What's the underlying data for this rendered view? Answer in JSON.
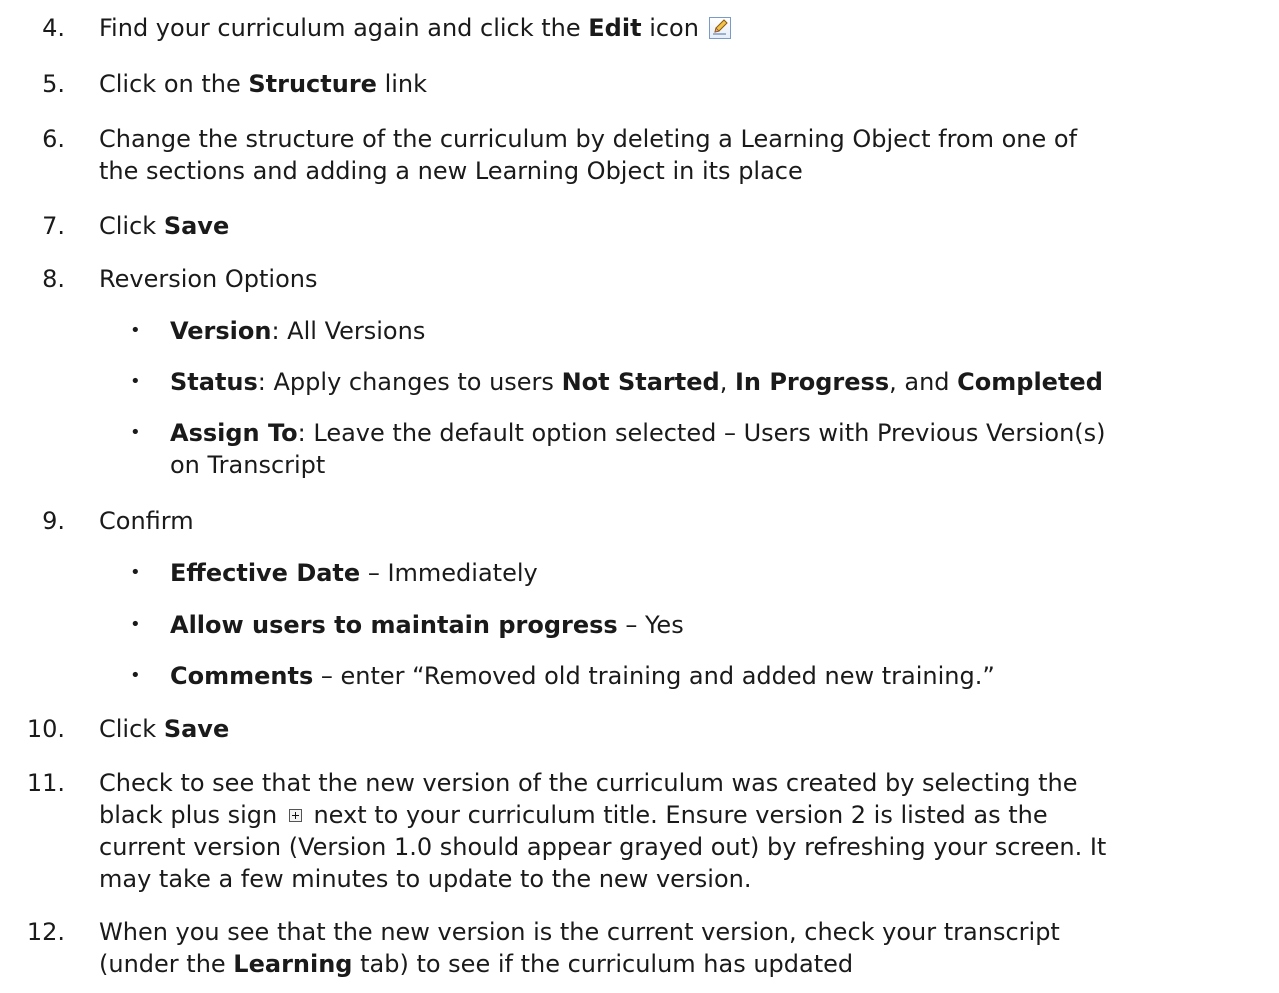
{
  "steps": [
    {
      "num": "4.",
      "parts": [
        "Find your curriculum again and click the ",
        "Edit",
        " icon"
      ],
      "icon": "edit-icon"
    },
    {
      "num": "5.",
      "parts": [
        "Click on the ",
        "Structure",
        " link"
      ]
    },
    {
      "num": "6.",
      "line1": "Change the structure of the curriculum by deleting a Learning Object from one of",
      "line2": "the sections and adding a new Learning Object in its place"
    },
    {
      "num": "7.",
      "parts": [
        "Click ",
        "Save"
      ]
    },
    {
      "num": "8.",
      "text": "Reversion Options"
    },
    {
      "num": "9.",
      "text": "Confirm"
    },
    {
      "num": "10.",
      "parts": [
        "Click ",
        "Save"
      ]
    },
    {
      "num": "11.",
      "line1": "Check to see that the new version of the curriculum was created by selecting the",
      "line2a": "black plus sign ",
      "line2b": " next to your curriculum title.  Ensure version 2 is listed as the",
      "line3": "current version (Version 1.0 should appear grayed out) by refreshing your screen. It",
      "line4": "may take a few minutes to update to the new version.",
      "icon": "plus-icon"
    },
    {
      "num": "12.",
      "line1": "When you see that the new version is the current version, check your transcript",
      "line2a": "(under the ",
      "line2b": "Learning",
      "line2c": " tab) to see if the curriculum has updated"
    }
  ],
  "reversion_options": [
    {
      "label": "Version",
      "rest": ":  All Versions"
    },
    {
      "label": "Status",
      "rest1": ":  Apply changes to users ",
      "b1": "Not Started",
      "rest2": ", ",
      "b2": "In Progress",
      "rest3": ", and ",
      "b3": "Completed"
    },
    {
      "label": "Assign To",
      "rest": ":  Leave the default option selected – Users with Previous Version(s)",
      "line2": "on Transcript"
    }
  ],
  "confirm_options": [
    {
      "label": "Effective Date",
      "rest": " – Immediately"
    },
    {
      "label": "Allow users to maintain progress",
      "rest": " – Yes"
    },
    {
      "label": "Comments",
      "rest": " – enter “Removed old training and added new training.”"
    }
  ],
  "bullet_glyph": "•"
}
